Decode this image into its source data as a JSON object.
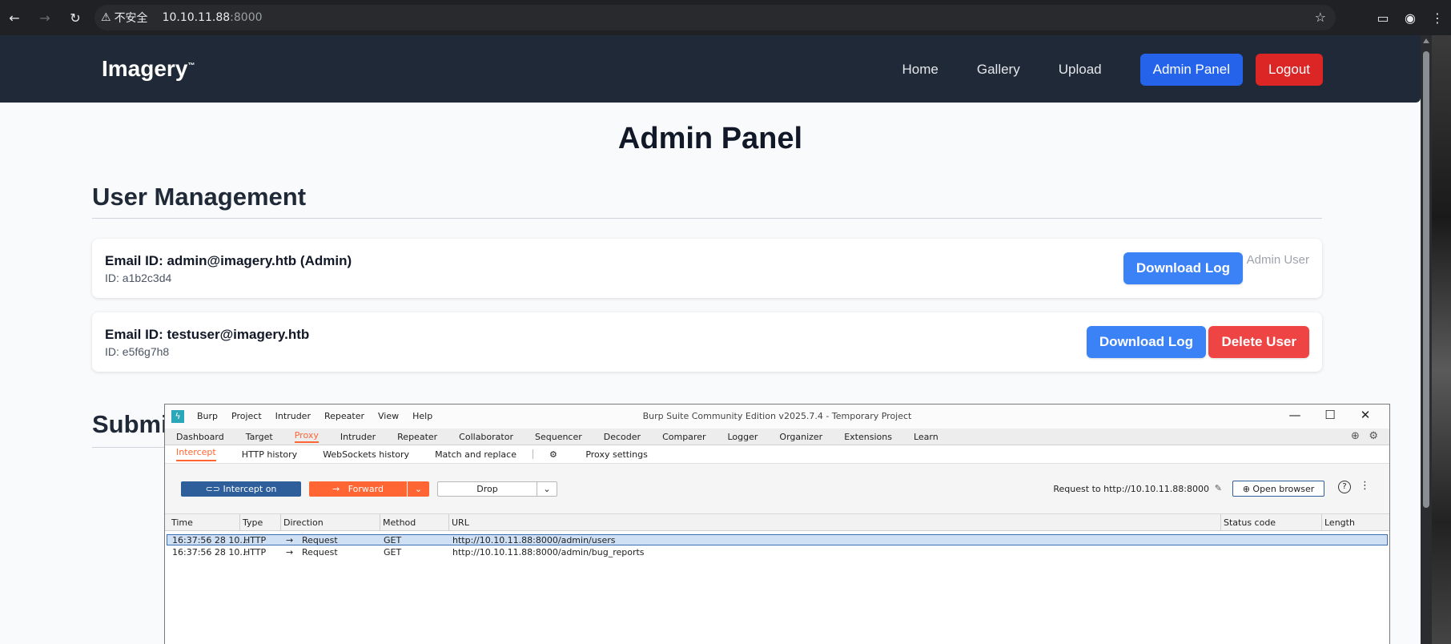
{
  "browser": {
    "security_icon": "warning-triangle-icon",
    "security_label": "不安全",
    "url_host": "10.10.11.88",
    "url_port": ":8000"
  },
  "site": {
    "logo": "Imagery",
    "logo_tm": "™",
    "nav": {
      "home": "Home",
      "gallery": "Gallery",
      "upload": "Upload",
      "admin_panel": "Admin Panel",
      "logout": "Logout"
    },
    "colors": {
      "header_bg": "#1f2937",
      "primary_blue": "#2563eb",
      "danger_red": "#dc2626"
    }
  },
  "admin": {
    "page_title": "Admin Panel",
    "user_mgmt_title": "User Management",
    "section2_title_visible": "Submi",
    "users": [
      {
        "email": "Email ID: admin@imagery.htb (Admin)",
        "id": "ID: a1b2c3d4",
        "download_label": "Download Log",
        "role_tag": "Admin User"
      },
      {
        "email": "Email ID: testuser@imagery.htb",
        "id": "ID: e5f6g7h8",
        "download_label": "Download Log",
        "delete_label": "Delete User"
      }
    ]
  },
  "burp": {
    "window_title": "Burp Suite Community Edition v2025.7.4 - Temporary Project",
    "menu": [
      "Burp",
      "Project",
      "Intruder",
      "Repeater",
      "View",
      "Help"
    ],
    "tabs": [
      "Dashboard",
      "Target",
      "Proxy",
      "Intruder",
      "Repeater",
      "Collaborator",
      "Sequencer",
      "Decoder",
      "Comparer",
      "Logger",
      "Organizer",
      "Extensions",
      "Learn"
    ],
    "active_tab": "Proxy",
    "subtabs": [
      "Intercept",
      "HTTP history",
      "WebSockets history",
      "Match and replace"
    ],
    "proxy_settings": "Proxy settings",
    "intercept_label": "Intercept on",
    "forward_label": "Forward",
    "drop_label": "Drop",
    "request_to": "Request to http://10.10.11.88:8000",
    "open_browser": "Open browser",
    "columns": [
      "Time",
      "Type",
      "Direction",
      "Method",
      "URL",
      "Status code",
      "Length"
    ],
    "rows": [
      {
        "time": "16:37:56 28 10...",
        "type": "HTTP",
        "direction": "Request",
        "method": "GET",
        "url": "http://10.10.11.88:8000/admin/users",
        "selected": true
      },
      {
        "time": "16:37:56 28 10...",
        "type": "HTTP",
        "direction": "Request",
        "method": "GET",
        "url": "http://10.10.11.88:8000/admin/bug_reports",
        "selected": false
      }
    ],
    "accent_color": "#ff6633",
    "intercept_color": "#2f5f9b"
  }
}
